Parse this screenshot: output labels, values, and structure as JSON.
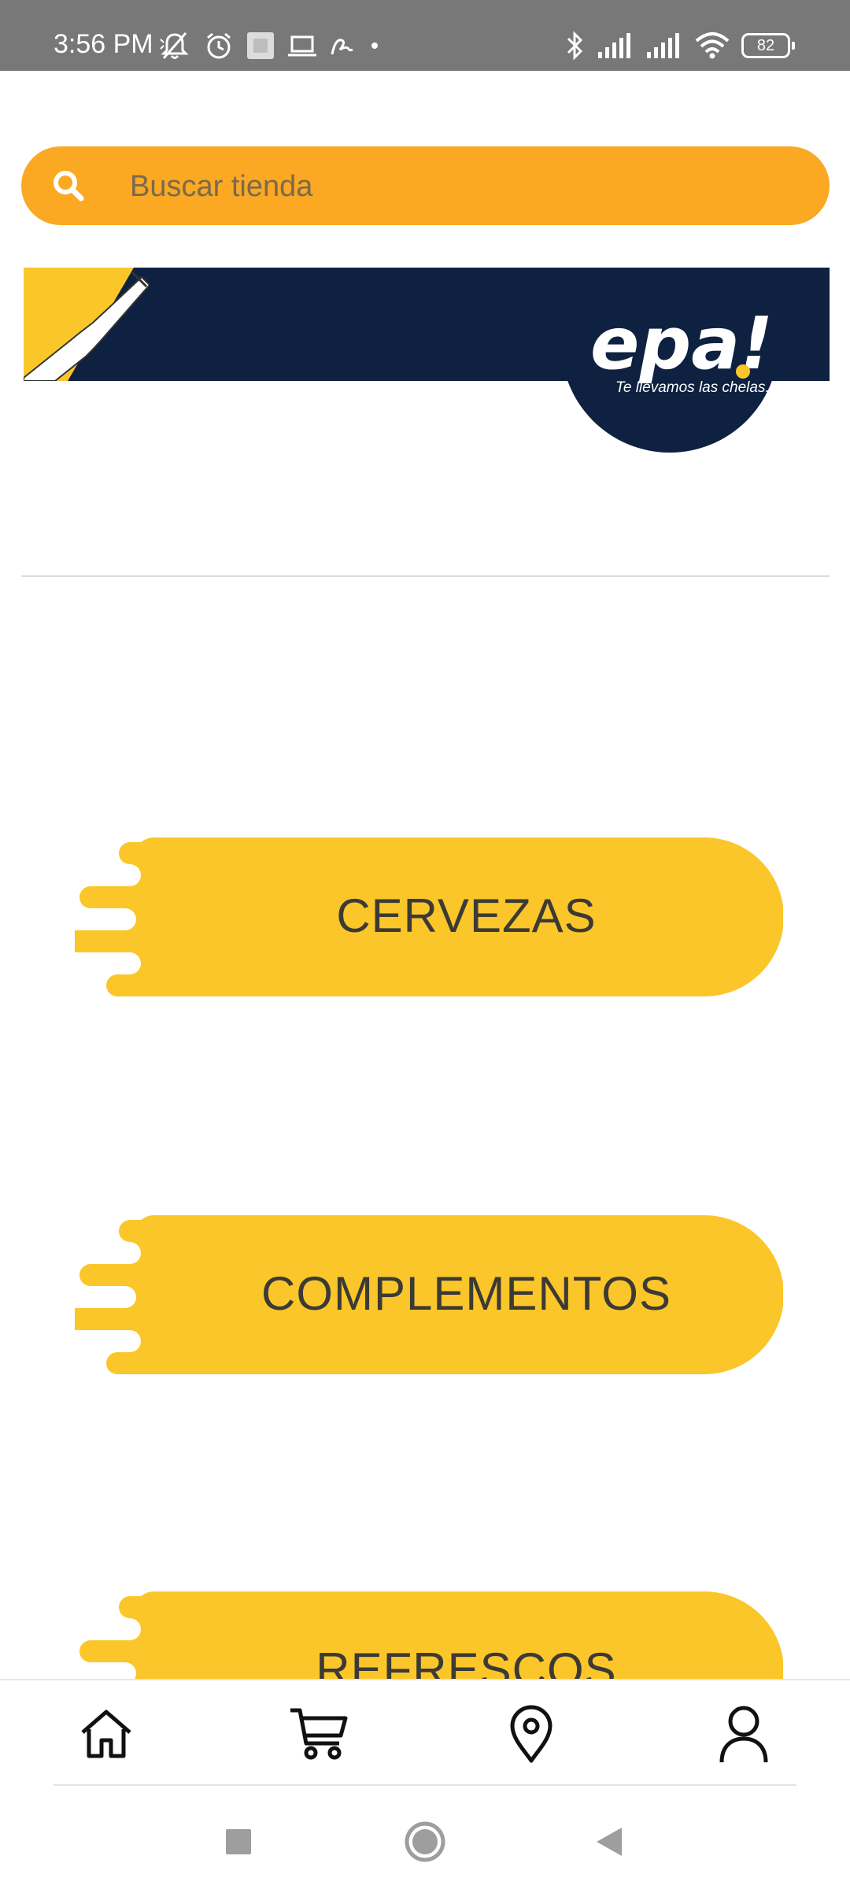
{
  "status_bar": {
    "time": "3:56 PM",
    "battery": "82"
  },
  "search": {
    "placeholder": "Buscar tienda",
    "value": ""
  },
  "banner": {
    "brand": "epa!",
    "tagline": "Te llevamos las chelas..."
  },
  "categories": [
    {
      "label": "CERVEZAS"
    },
    {
      "label": "COMPLEMENTOS"
    },
    {
      "label": "REFRESCOS"
    }
  ],
  "bottom_nav": {
    "items": [
      {
        "icon": "home-icon"
      },
      {
        "icon": "cart-icon"
      },
      {
        "icon": "location-pin-icon"
      },
      {
        "icon": "user-profile-icon"
      }
    ]
  },
  "colors": {
    "status_bar": "#787878",
    "search_bar": "#fba823",
    "category_blob": "#fbc62a",
    "banner_navy": "#0f2141",
    "banner_yellow": "#fbc62a"
  }
}
